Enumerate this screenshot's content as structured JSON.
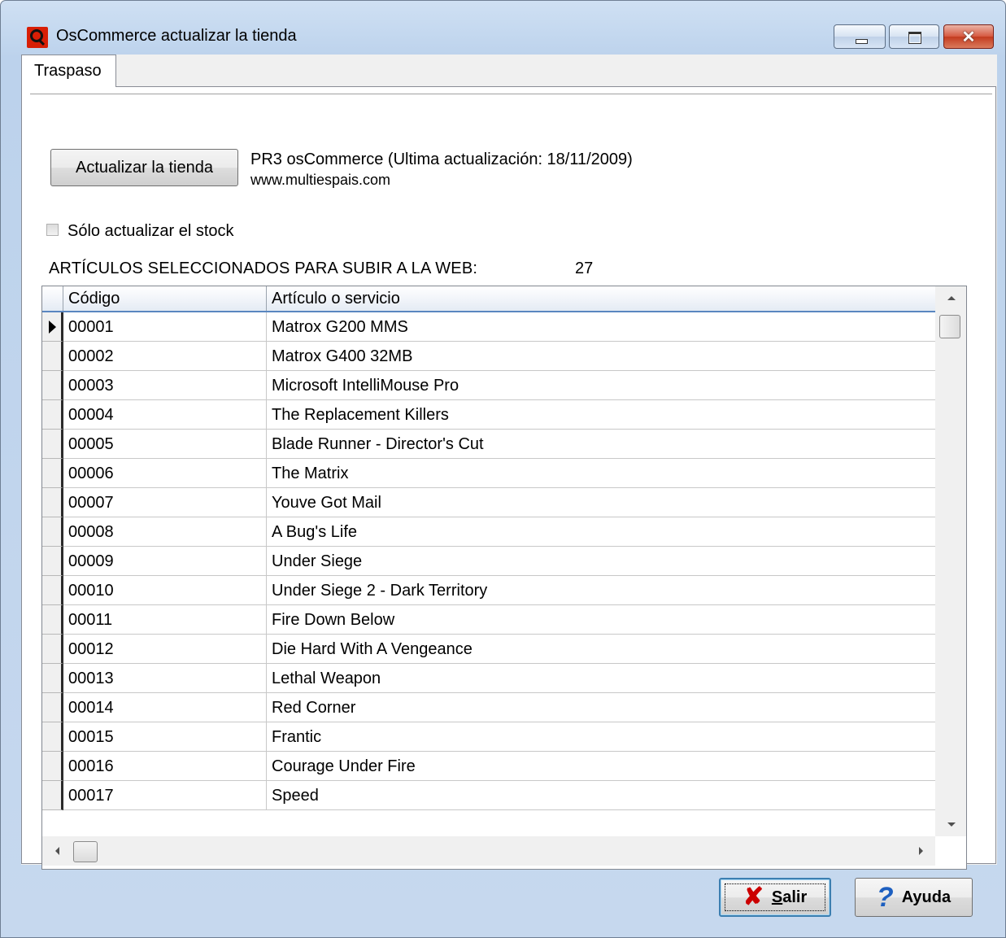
{
  "window": {
    "title": "OsCommerce actualizar la tienda",
    "app_icon": "q-red-logo-icon",
    "controls": {
      "minimize": "minimize-icon",
      "maximize": "maximize-icon",
      "close": "close-icon"
    },
    "accent_color": "#c33b1f"
  },
  "tabs": [
    {
      "label": "Traspaso",
      "selected": true
    }
  ],
  "panel": {
    "update_button": "Actualizar la tienda",
    "store_info": "PR3 osCommerce  (Ultima actualización: 18/11/2009)",
    "store_url": "www.multiespais.com",
    "only_stock_checkbox": {
      "label": "Sólo actualizar el stock",
      "checked": false
    },
    "selected_label": "ARTÍCULOS SELECCIONADOS PARA SUBIR A LA WEB:",
    "selected_count": "27"
  },
  "grid": {
    "columns": [
      "Código",
      "Artículo o servicio"
    ],
    "current_row": 0,
    "rows": [
      [
        "00001",
        "Matrox G200 MMS"
      ],
      [
        "00002",
        "Matrox G400 32MB"
      ],
      [
        "00003",
        "Microsoft IntelliMouse Pro"
      ],
      [
        "00004",
        "The Replacement Killers"
      ],
      [
        "00005",
        "Blade Runner - Director's Cut"
      ],
      [
        "00006",
        "The Matrix"
      ],
      [
        "00007",
        "Youve Got Mail"
      ],
      [
        "00008",
        "A Bug's Life"
      ],
      [
        "00009",
        "Under Siege"
      ],
      [
        "00010",
        "Under Siege 2 - Dark Territory"
      ],
      [
        "00011",
        "Fire Down Below"
      ],
      [
        "00012",
        "Die Hard With A Vengeance"
      ],
      [
        "00013",
        "Lethal Weapon"
      ],
      [
        "00014",
        "Red Corner"
      ],
      [
        "00015",
        "Frantic"
      ],
      [
        "00016",
        "Courage Under Fire"
      ],
      [
        "00017",
        "Speed"
      ]
    ]
  },
  "footer": {
    "exit_button": {
      "label": "Salir",
      "icon": "red-x-icon"
    },
    "help_button": {
      "label": "Ayuda",
      "icon": "question-mark-icon"
    }
  }
}
